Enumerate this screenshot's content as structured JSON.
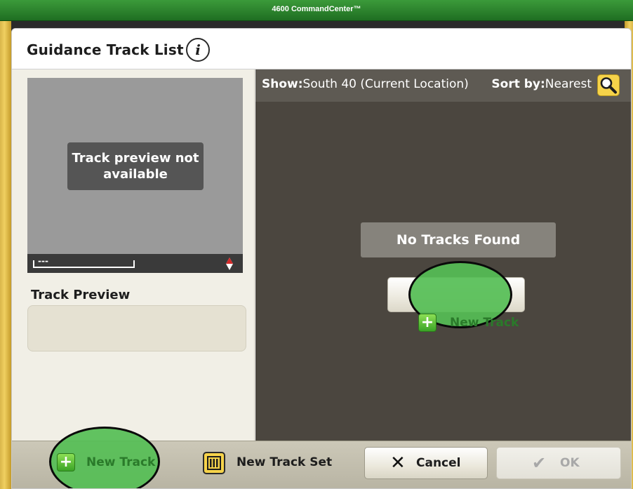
{
  "topbar": {
    "title": "4600 CommandCenter™"
  },
  "dialog": {
    "title": "Guidance Track List",
    "info_icon": "i"
  },
  "left_panel": {
    "preview_message": "Track preview not available",
    "scale_text": "---",
    "track_preview_label": "Track Preview"
  },
  "right_panel": {
    "show_label": "Show:",
    "show_value": "South 40 (Current Location)",
    "sort_label": "Sort by:",
    "sort_value": "Nearest",
    "sort_icon": "search-icon",
    "empty_message": "No Tracks Found",
    "new_track_label": "New Track"
  },
  "bottom_bar": {
    "new_track_label": "New Track",
    "new_track_set_label": "New Track Set",
    "cancel_label": "Cancel",
    "ok_label": "OK",
    "ok_enabled": false
  },
  "colors": {
    "brand_green": "#367c2b",
    "highlight_green": "#55be55",
    "accent_yellow": "#f6d34a",
    "list_background": "#4b463f"
  }
}
